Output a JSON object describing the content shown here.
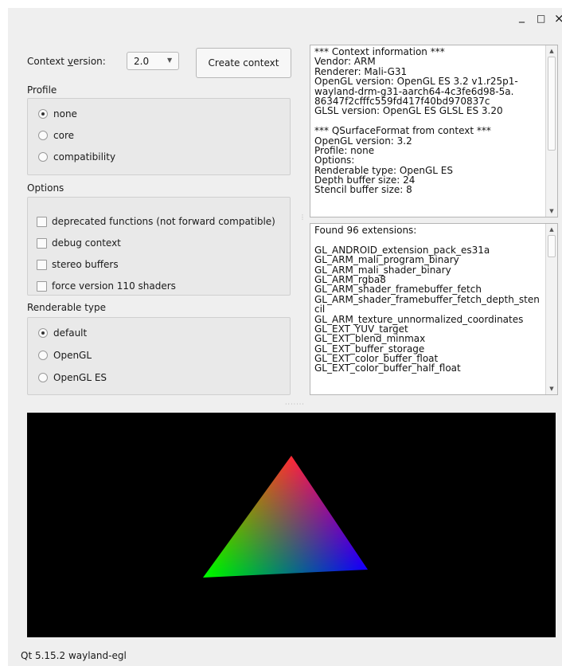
{
  "window": {
    "minimize_glyph": "_",
    "maximize_glyph": "□",
    "close_glyph": "×"
  },
  "context": {
    "version_label_pre": "Context ",
    "version_label_accel": "v",
    "version_label_post": "ersion:",
    "version_value": "2.0",
    "create_button": "Create context"
  },
  "profile": {
    "title": "Profile",
    "options": [
      "none",
      "core",
      "compatibility"
    ],
    "selected": 0
  },
  "options": {
    "title": "Options",
    "items": [
      "deprecated functions (not forward compatible)",
      "debug context",
      "stereo buffers",
      "force version 110 shaders"
    ]
  },
  "renderable": {
    "title": "Renderable type",
    "options": [
      "default",
      "OpenGL",
      "OpenGL ES"
    ],
    "selected": 0
  },
  "info_text": [
    "*** Context information ***",
    "Vendor: ARM",
    "Renderer: Mali-G31",
    "OpenGL version: OpenGL ES 3.2 v1.r25p1-",
    "wayland-drm-g31-aarch64-4c3fe6d98-5a.",
    "86347f2cfffc559fd417f40bd970837c",
    "GLSL version: OpenGL ES GLSL ES 3.20",
    "",
    "*** QSurfaceFormat from context ***",
    "OpenGL version: 3.2",
    "Profile: none",
    "Options:",
    "Renderable type: OpenGL ES",
    "Depth buffer size: 24",
    "Stencil buffer size: 8"
  ],
  "extensions_text": [
    "Found 96 extensions:",
    "",
    "GL_ANDROID_extension_pack_es31a",
    "GL_ARM_mali_program_binary",
    "GL_ARM_mali_shader_binary",
    "GL_ARM_rgba8",
    "GL_ARM_shader_framebuffer_fetch",
    "GL_ARM_shader_framebuffer_fetch_depth_sten",
    "cil",
    "GL_ARM_texture_unnormalized_coordinates",
    "GL_EXT_YUV_target",
    "GL_EXT_blend_minmax",
    "GL_EXT_buffer_storage",
    "GL_EXT_color_buffer_float",
    "GL_EXT_color_buffer_half_float"
  ],
  "triangle_colors": {
    "top": "#ff0000",
    "left": "#00ff00",
    "right": "#0000ff"
  },
  "status": "Qt 5.15.2 wayland-egl"
}
